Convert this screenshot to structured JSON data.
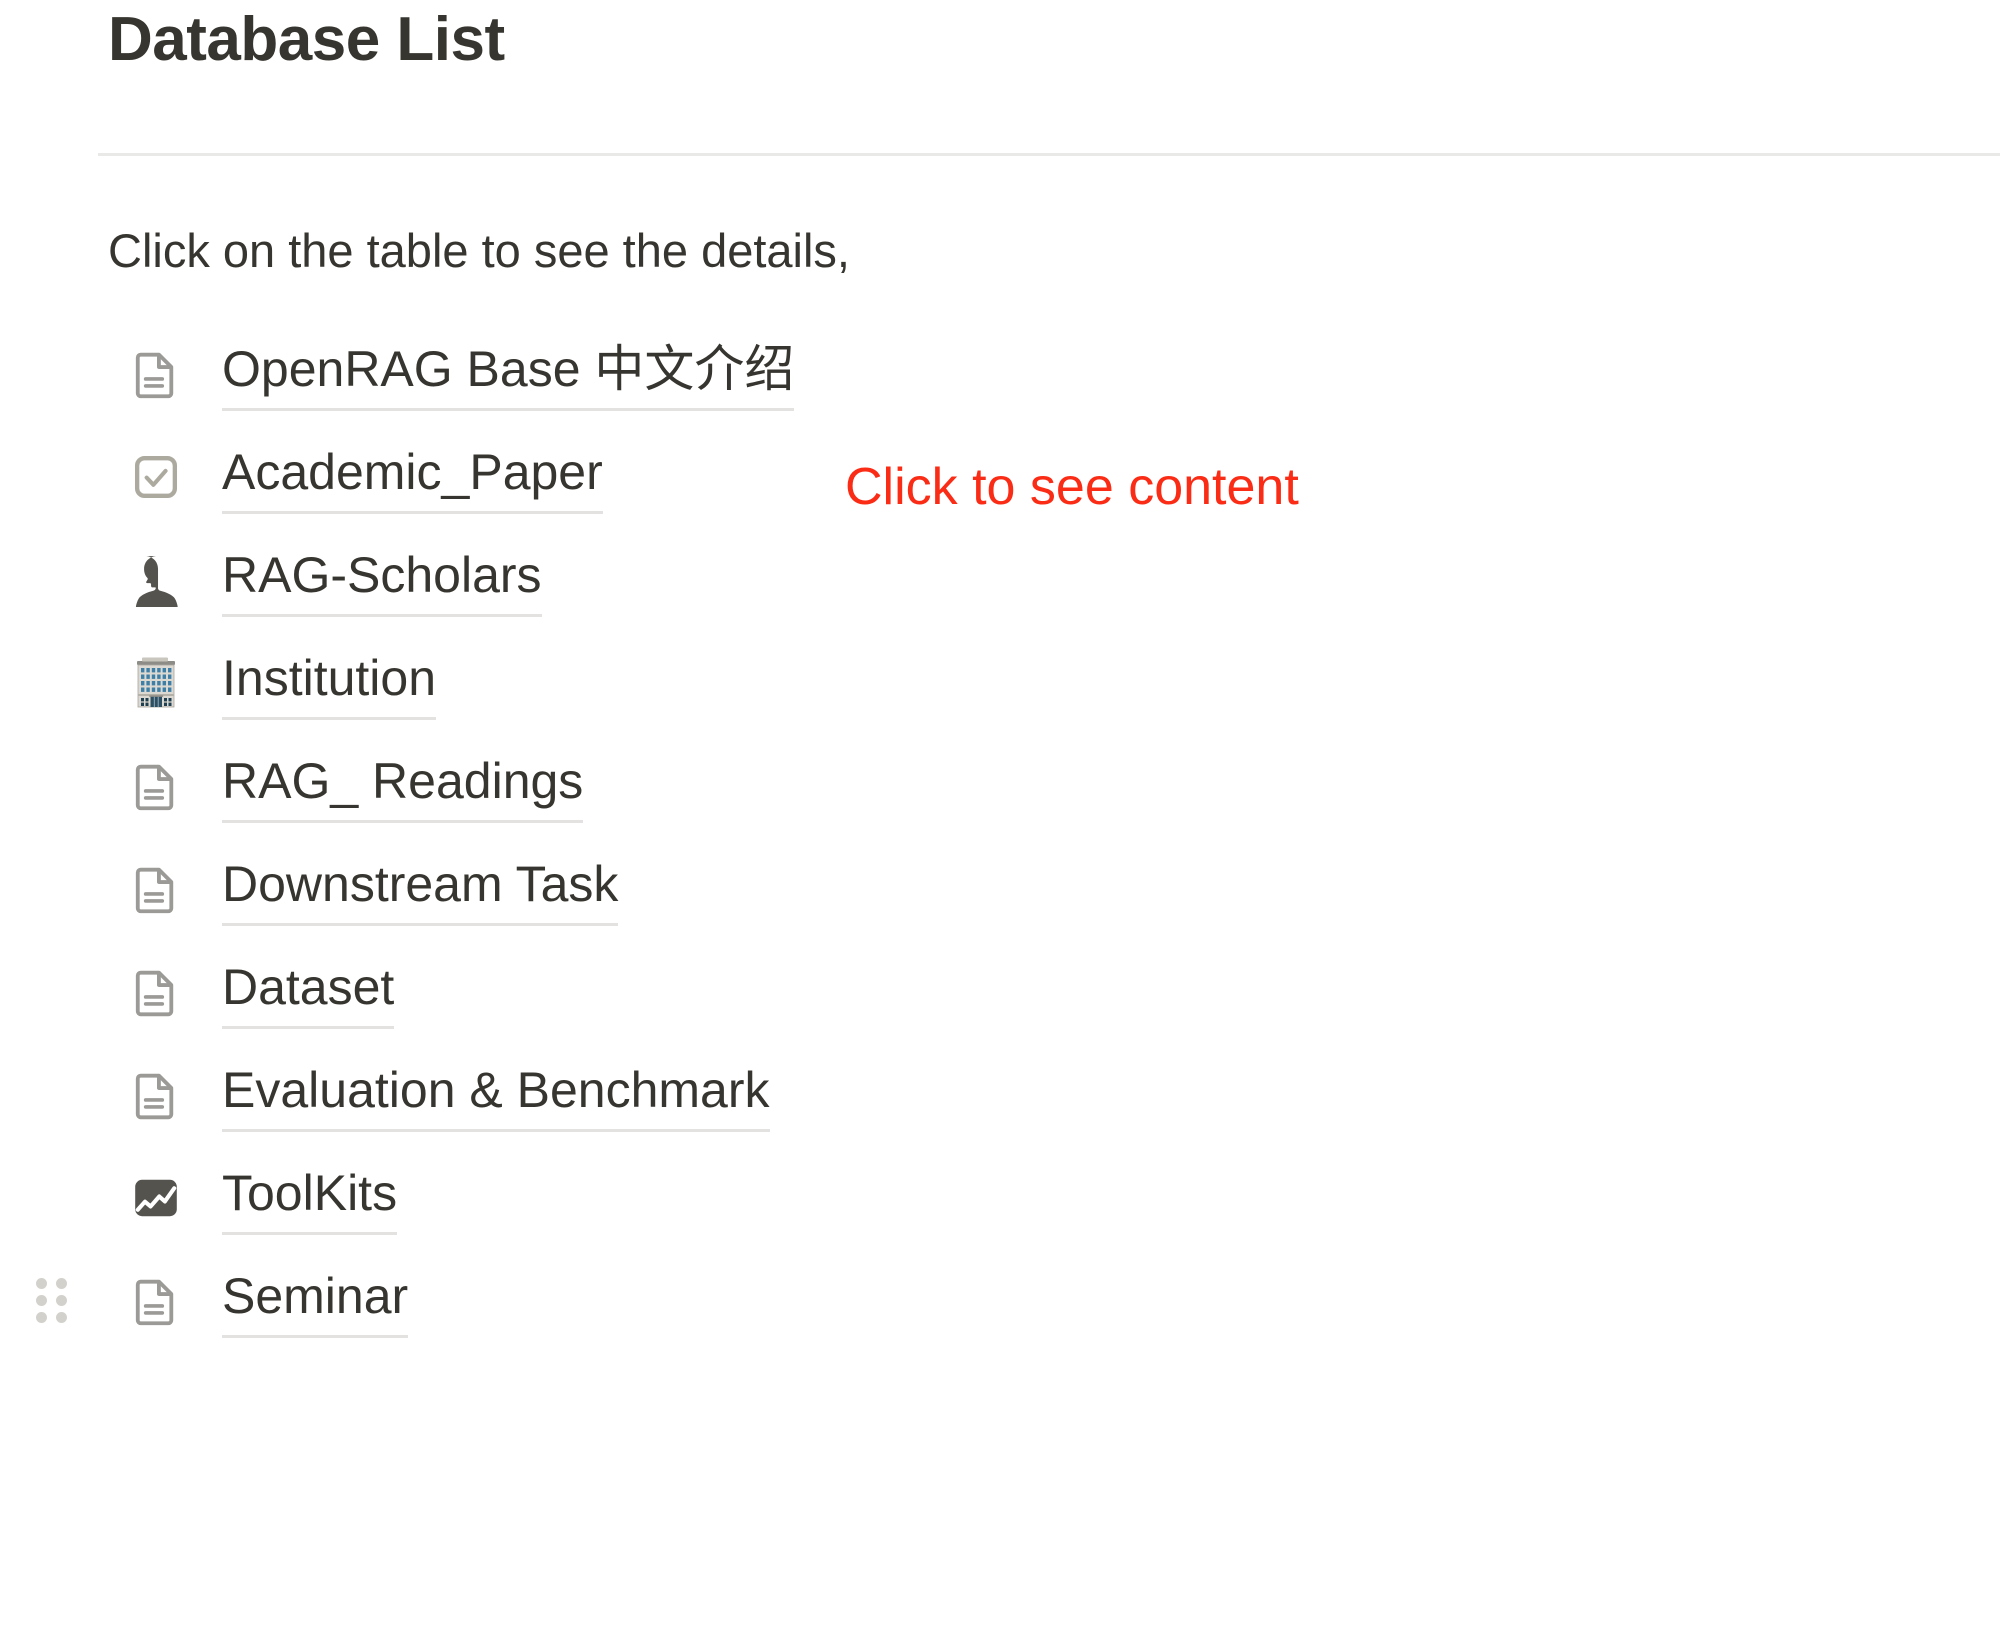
{
  "page": {
    "title": "Database List",
    "intro": "Click on the table to see the details,"
  },
  "annotation": {
    "text": "Click to see content",
    "color": "#FA2C16"
  },
  "colors": {
    "text": "#37352F",
    "divider": "#E9E9E7",
    "link_underline": "#E3E2E0",
    "icon_gray": "#9B9A97",
    "icon_dark": "#55534E",
    "drag_dot": "#D3D1CB",
    "accent_red": "#FA2C16"
  },
  "list": {
    "items": [
      {
        "label": "OpenRAG Base 中文介绍",
        "icon": "document-icon",
        "name": "openrag-base-chinese-intro"
      },
      {
        "label": "Academic_Paper",
        "icon": "checkbox-checked-icon",
        "name": "academic-paper"
      },
      {
        "label": "RAG-Scholars",
        "icon": "person-bust-icon",
        "name": "rag-scholars"
      },
      {
        "label": "Institution",
        "icon": "office-building-icon",
        "name": "institution"
      },
      {
        "label": "RAG_ Readings",
        "icon": "document-icon",
        "name": "rag-readings"
      },
      {
        "label": "Downstream Task",
        "icon": "document-icon",
        "name": "downstream-task"
      },
      {
        "label": "Dataset",
        "icon": "document-icon",
        "name": "dataset"
      },
      {
        "label": "Evaluation & Benchmark",
        "icon": "document-icon",
        "name": "evaluation-and-benchmark"
      },
      {
        "label": "ToolKits",
        "icon": "line-chart-icon",
        "name": "toolkits"
      },
      {
        "label": "Seminar",
        "icon": "document-icon",
        "name": "seminar"
      }
    ]
  }
}
